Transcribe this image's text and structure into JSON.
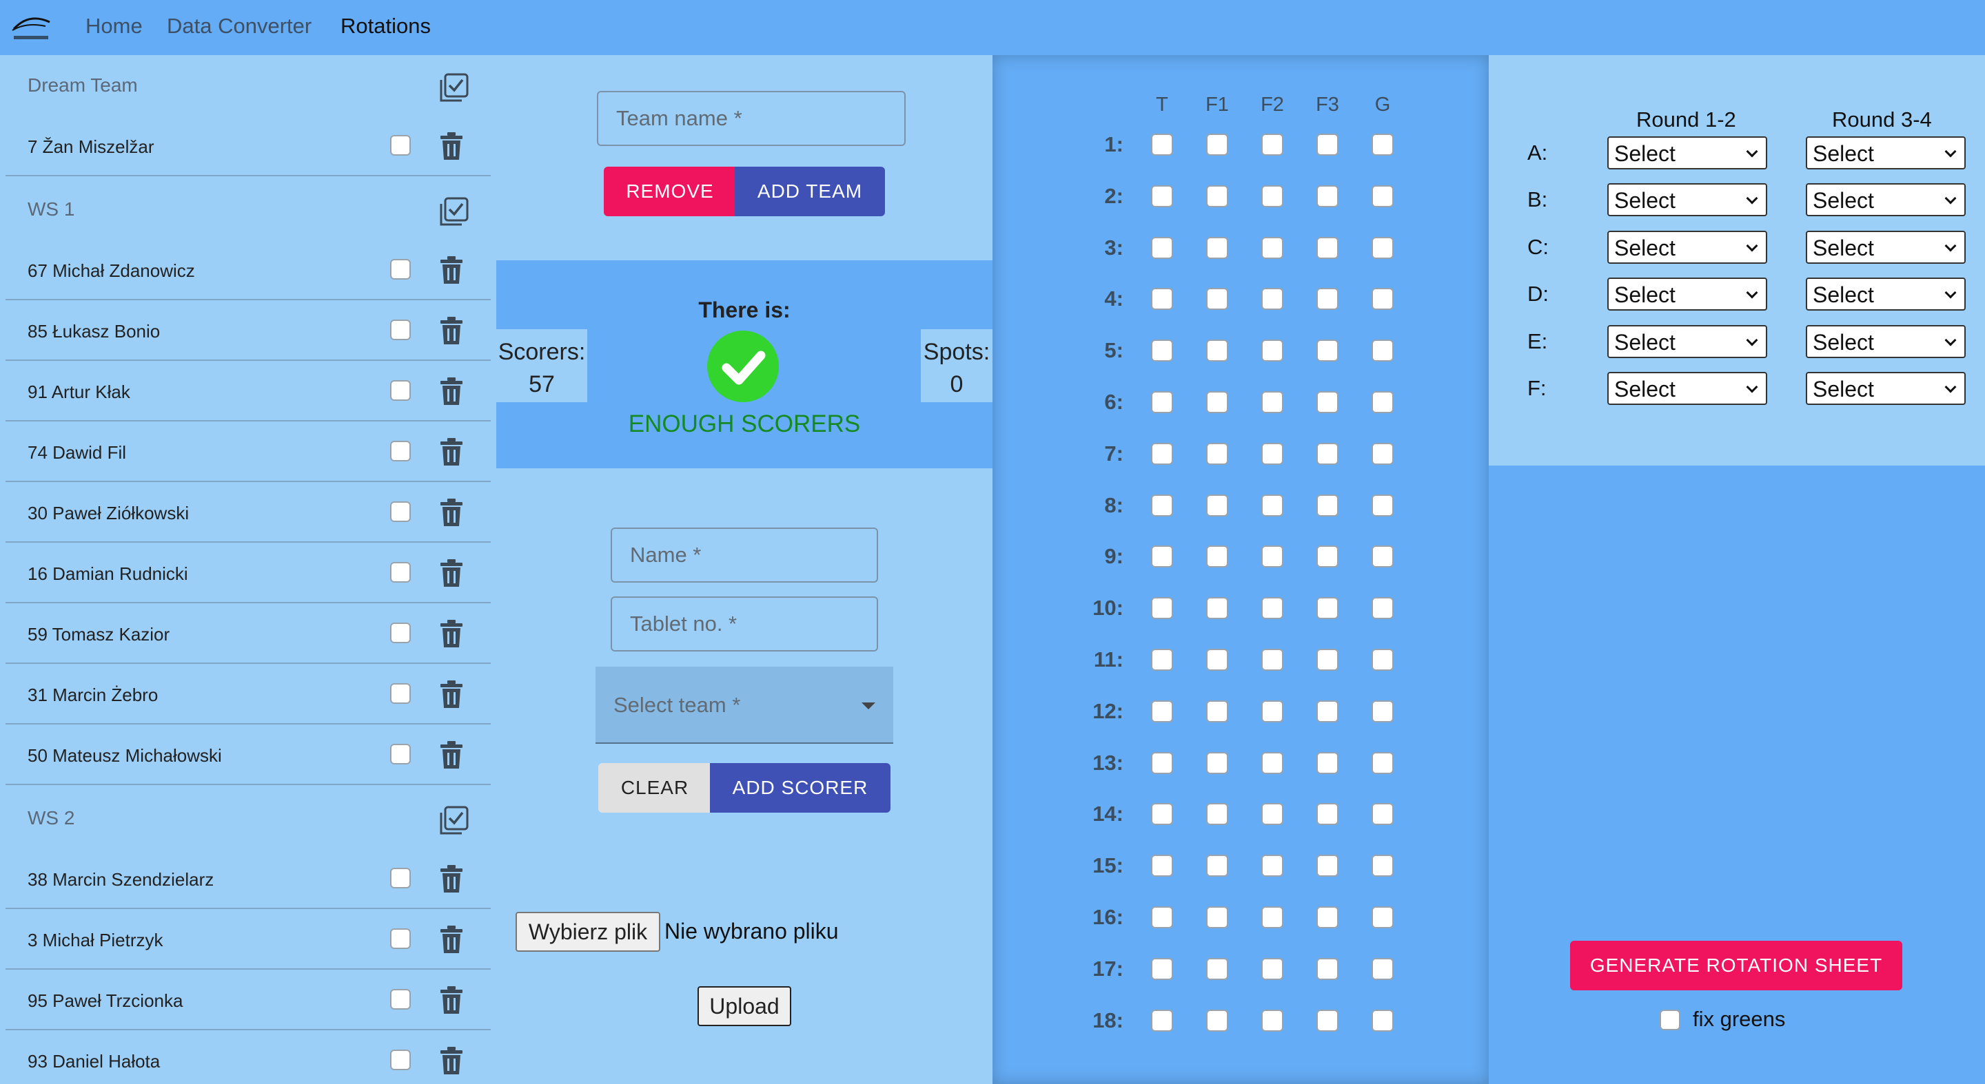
{
  "nav": {
    "links": [
      "Home",
      "Data Converter",
      "Rotations"
    ],
    "active": "Rotations"
  },
  "teams": [
    {
      "name": "Dream Team",
      "players": [
        "7 Žan Miszelžar"
      ]
    },
    {
      "name": "WS 1",
      "players": [
        "67 Michał Zdanowicz",
        "85 Łukasz Bonio",
        "91 Artur Kłak",
        "74 Dawid Fil",
        "30 Paweł Ziółkowski",
        "16 Damian Rudnicki",
        "59 Tomasz Kazior",
        "31 Marcin Żebro",
        "50 Mateusz Michałowski"
      ]
    },
    {
      "name": "WS 2",
      "players": [
        "38 Marcin Szendzielarz",
        "3 Michał Pietrzyk",
        "95 Paweł Trzcionka",
        "93 Daniel Hałota"
      ]
    }
  ],
  "team_form": {
    "team_name_placeholder": "Team name *",
    "remove_label": "REMOVE",
    "add_team_label": "ADD TEAM"
  },
  "status": {
    "there_is": "There is:",
    "scorers_label": "Scorers:",
    "scorers_value": "57",
    "spots_label": "Spots:",
    "spots_value": "0",
    "message": "ENOUGH SCORERS",
    "ok_color": "#33d42e"
  },
  "scorer_form": {
    "name_placeholder": "Name *",
    "tablet_placeholder": "Tablet no. *",
    "team_placeholder": "Select team *",
    "clear_label": "CLEAR",
    "add_scorer_label": "ADD SCORER"
  },
  "file": {
    "choose_label": "Wybierz plik",
    "status": "Nie wybrano pliku",
    "upload_label": "Upload"
  },
  "grid": {
    "columns": [
      "T",
      "F1",
      "F2",
      "F3",
      "G"
    ],
    "holes": [
      "1:",
      "2:",
      "3:",
      "4:",
      "5:",
      "6:",
      "7:",
      "8:",
      "9:",
      "10:",
      "11:",
      "12:",
      "13:",
      "14:",
      "15:",
      "16:",
      "17:",
      "18:"
    ]
  },
  "rounds": {
    "headers": [
      "Round 1-2",
      "Round 3-4"
    ],
    "letters": [
      "A:",
      "B:",
      "C:",
      "D:",
      "E:",
      "F:"
    ],
    "select_value": "Select"
  },
  "actions": {
    "generate_label": "GENERATE ROTATION SHEET",
    "fix_greens_label": "fix greens"
  },
  "colors": {
    "nav_bg": "#64acf5",
    "panel_light": "#9ccff8",
    "accent_pink": "#f0135e",
    "accent_indigo": "#3f51b5",
    "success_green": "#168a22"
  }
}
